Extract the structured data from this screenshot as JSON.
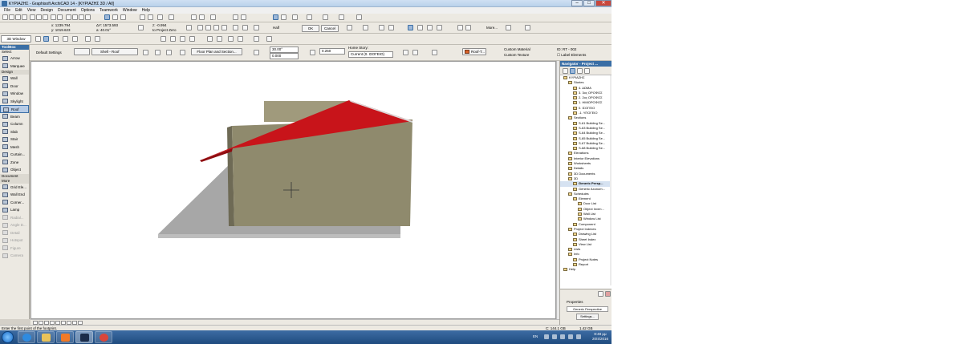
{
  "window": {
    "title": "ΚΥΡΙΑΖΗΣ - Graphisoft ArchiCAD 14 - [ΚΥΡΙΑΖΗΣ 3D / All]"
  },
  "menu": [
    "File",
    "Edit",
    "View",
    "Design",
    "Document",
    "Options",
    "Teamwork",
    "Window",
    "Help"
  ],
  "coords": {
    "x_label": "x:",
    "x_value": "1239.794",
    "y_label": "y:",
    "y_value": "1019.623",
    "dx_label": "ΔY:",
    "dx_value": "1573.593",
    "angle_label": "a:",
    "angle_value": "40.01°",
    "z_label": "z:",
    "z_value": "-0.994",
    "project_zero": "to Project Zero",
    "zoom_value": "Half",
    "ok_label": "OK",
    "cancel_label": "Cancel",
    "more_label": "More..."
  },
  "view_tab": "3D Window",
  "infobox": {
    "default_settings": "Default Settings",
    "shell_roof": "Shell - Roof",
    "floor_plan_section": "Floor Plan and Section...",
    "angle1": "30.00°",
    "angle2": "0.000",
    "thickness": "0.250",
    "home_story_label": "Home Story:",
    "home_story_value": "Current (0. ΙΣΟΓΕΙΟ)",
    "roof_material": "Roof-T...",
    "custom_material": "Custom Material",
    "custom_texture": "Custom Texture",
    "id_label": "ID:",
    "id_value": "RT - 002",
    "label_elements": "Label Elements"
  },
  "toolbox": {
    "title": "ToolBox",
    "select_label": "Select",
    "sections": {
      "design": "Design",
      "document": "Document",
      "more": "More"
    },
    "select_tools": [
      "Arrow",
      "Marquee"
    ],
    "design_tools": [
      "Wall",
      "Door",
      "Window",
      "Skylight",
      "Roof",
      "Beam",
      "Column",
      "Slab",
      "Stair",
      "Mesh",
      "Curtain...",
      "Zone",
      "Object"
    ],
    "more_tools": [
      "Grid Ele...",
      "Wall End",
      "Corner...",
      "Lamp",
      "Radial...",
      "Angle D...",
      "Detail",
      "Hotspot",
      "Figure",
      "Camera"
    ],
    "active_tool": "Roof"
  },
  "navigator": {
    "title": "Navigator - Project ...",
    "tree": [
      {
        "label": "ΚΥΡΙΑΖΗΣ",
        "level": 0
      },
      {
        "label": "Stories",
        "level": 1
      },
      {
        "label": "4. ΔΩΜΑ",
        "level": 2
      },
      {
        "label": "3. 3ος ΟΡΟΦΟΣ",
        "level": 2
      },
      {
        "label": "2. 2ος ΟΡΟΦΟΣ",
        "level": 2
      },
      {
        "label": "1. ΗΜΙΟΡΟΦΟΣ",
        "level": 2
      },
      {
        "label": "0. ΙΣΟΓΕΙΟ",
        "level": 2
      },
      {
        "label": "-1. ΥΠΟΓΕΙΟ",
        "level": 2
      },
      {
        "label": "Sections",
        "level": 1
      },
      {
        "label": "S-61 Building Se...",
        "level": 2
      },
      {
        "label": "S-63 Building Se...",
        "level": 2
      },
      {
        "label": "S-64 Building Se...",
        "level": 2
      },
      {
        "label": "S-65 Building Se...",
        "level": 2
      },
      {
        "label": "S-67 Building Se...",
        "level": 2
      },
      {
        "label": "S-68 Building Se...",
        "level": 2
      },
      {
        "label": "Elevations",
        "level": 1
      },
      {
        "label": "Interior Elevations",
        "level": 1
      },
      {
        "label": "Worksheets",
        "level": 1
      },
      {
        "label": "Details",
        "level": 1
      },
      {
        "label": "3D Documents",
        "level": 1
      },
      {
        "label": "3D",
        "level": 1
      },
      {
        "label": "Generic Persp...",
        "level": 2,
        "selected": true
      },
      {
        "label": "Generic Axonom...",
        "level": 2
      },
      {
        "label": "Schedules",
        "level": 1
      },
      {
        "label": "Element",
        "level": 2
      },
      {
        "label": "Door List",
        "level": 3
      },
      {
        "label": "Object Inven...",
        "level": 3
      },
      {
        "label": "Wall List",
        "level": 3
      },
      {
        "label": "Window List",
        "level": 3
      },
      {
        "label": "Component",
        "level": 2
      },
      {
        "label": "Project Indexes",
        "level": 1
      },
      {
        "label": "Drawing List",
        "level": 2
      },
      {
        "label": "Sheet Index",
        "level": 2
      },
      {
        "label": "View List",
        "level": 2
      },
      {
        "label": "Lists",
        "level": 1
      },
      {
        "label": "Info",
        "level": 1
      },
      {
        "label": "Project Notes",
        "level": 2
      },
      {
        "label": "Report",
        "level": 2
      },
      {
        "label": "Help",
        "level": 0
      }
    ],
    "properties_label": "Properties",
    "properties_value": "Generic Perspective",
    "settings_button": "Settings..."
  },
  "status": {
    "message": "Enter the first point of the footprint.",
    "disk1": "C: 144.1 GB",
    "disk2": "1.42 GB"
  },
  "taskbar": {
    "language": "EN",
    "time": "8:48 μμ",
    "date": "20/4/2016"
  },
  "colors": {
    "roof": "#c8141a",
    "roof_dark": "#8f0c10",
    "wall_front": "#8f8a6d",
    "wall_back": "#a09a7c",
    "shadow": "#a7a7a7",
    "base": "#bdbdbd",
    "selection_blue": "#3a6ea5"
  }
}
